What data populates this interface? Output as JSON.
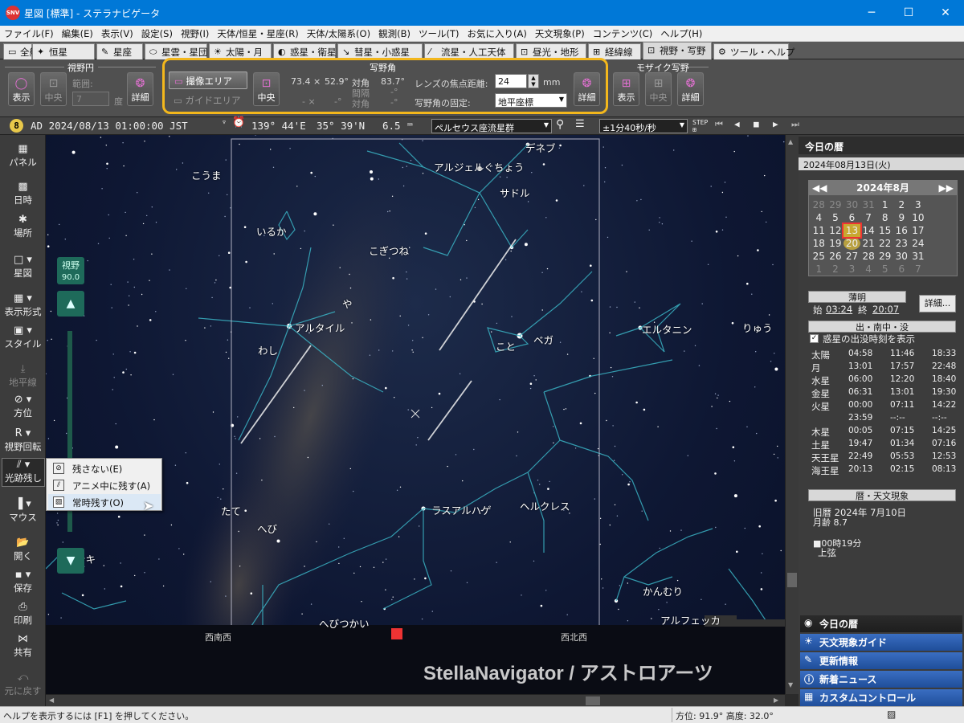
{
  "window": {
    "title": "星図 [標準] - ステラナビゲータ",
    "app_badge": "SNV"
  },
  "menu": [
    "ファイル(F)",
    "編集(E)",
    "表示(V)",
    "設定(S)",
    "視野(I)",
    "天体/恒星・星座(R)",
    "天体/太陽系(O)",
    "観測(B)",
    "ツール(T)",
    "お気に入り(A)",
    "天文現象(P)",
    "コンテンツ(C)",
    "ヘルプ(H)"
  ],
  "tabs": [
    {
      "label": "全般",
      "icon": "▭"
    },
    {
      "label": "恒星",
      "icon": "✦"
    },
    {
      "label": "星座",
      "icon": "✎"
    },
    {
      "label": "星雲・星団",
      "icon": "⬭"
    },
    {
      "label": "太陽・月",
      "icon": "☀"
    },
    {
      "label": "惑星・衛星",
      "icon": "◐"
    },
    {
      "label": "彗星・小惑星",
      "icon": "↘"
    },
    {
      "label": "流星・人工天体",
      "icon": "⁄"
    },
    {
      "label": "昼光・地形",
      "icon": "⊡"
    },
    {
      "label": "経緯線",
      "icon": "⊞"
    },
    {
      "label": "視野・写野",
      "icon": "⊡"
    },
    {
      "label": "ツール・ヘルプ",
      "icon": "⚙"
    }
  ],
  "ribbon": {
    "fov_circle": {
      "title": "視野円",
      "show": "表示",
      "center": "中央",
      "range_label": "範囲:",
      "range_value": "7",
      "unit": "度",
      "detail": "詳細"
    },
    "frame": {
      "title": "写野角",
      "capture_area": "撮像エリア",
      "guide_area": "ガイドエリア",
      "center": "中央",
      "size_a": "73.4 ×",
      "size_b": "52.9°",
      "diag_label": "対角",
      "diag_value": "83.7°",
      "dash_a": "- ×",
      "dash_b": "-°",
      "spacing_label": "間隔",
      "spacing_value": "-°",
      "diag2_label": "対角",
      "diag2_value": "-°",
      "focal_label": "レンズの焦点距離:",
      "focal_value": "24",
      "focal_unit": "mm",
      "fix_label": "写野角の固定:",
      "fix_value": "地平座標",
      "detail": "詳細"
    },
    "mosaic": {
      "title": "モザイク写野",
      "show": "表示",
      "center": "中央",
      "detail": "詳細"
    }
  },
  "status": {
    "badge": "8",
    "datetime": "AD 2024/08/13 01:00:00 JST",
    "lon": "139° 44'E",
    "lat": "35° 39'N",
    "mag": "6.5",
    "target": "ペルセウス座流星群",
    "speed": "±1分40秒/秒"
  },
  "leftbar": {
    "panel": "パネル",
    "datetime": "日時",
    "place": "場所",
    "chart": "星図",
    "display": "表示形式",
    "style": "スタイル",
    "horizon": "地平線",
    "direction": "方位",
    "rotate": "視野回転",
    "trail": "光跡残し",
    "mouse": "マウス",
    "open": "開く",
    "save": "保存",
    "print": "印刷",
    "share": "共有",
    "undo": "元に戻す",
    "fov_label": "視野",
    "fov_value": "90.0"
  },
  "popup": [
    "残さない(E)",
    "アニメ中に残す(A)",
    "常時残す(O)"
  ],
  "sky": {
    "labels": [
      "デネブ",
      "アルジェルぐちょう",
      "サドル",
      "こうま",
      "いるか",
      "こぎつね",
      "や",
      "アルタイル",
      "わし",
      "こと",
      "ベガ",
      "エルタニン",
      "りゅう",
      "たて",
      "へび",
      "ラスアルハゲ",
      "ヘルクレス",
      "アンキ",
      "へびつかい",
      "かんむり",
      "アルフェッカ",
      "西南西",
      "西北西"
    ],
    "watermark": "StellaNavigator / アストロアーツ"
  },
  "right": {
    "title": "今日の暦",
    "date": "2024年08月13日(火)",
    "cal_month": "2024年8月",
    "cal_weeks": [
      [
        "28",
        "29",
        "30",
        "31",
        "1",
        "2",
        "3"
      ],
      [
        "4",
        "5",
        "6",
        "7",
        "8",
        "9",
        "10"
      ],
      [
        "11",
        "12",
        "13",
        "14",
        "15",
        "16",
        "17"
      ],
      [
        "18",
        "19",
        "20",
        "21",
        "22",
        "23",
        "24"
      ],
      [
        "25",
        "26",
        "27",
        "28",
        "29",
        "30",
        "31"
      ],
      [
        "1",
        "2",
        "3",
        "4",
        "5",
        "6",
        "7"
      ]
    ],
    "twilight_title": "薄明",
    "tw_start_label": "始",
    "tw_start": "03:24",
    "tw_end_label": "終",
    "tw_end": "20:07",
    "detail_btn": "詳細...",
    "rise_title": "出・南中・没",
    "planet_check": "惑星の出没時刻を表示",
    "rise_rows": [
      [
        "太陽",
        "04:58",
        "11:46",
        "18:33"
      ],
      [
        "月",
        "13:01",
        "17:57",
        "22:48"
      ],
      [
        "水星",
        "06:00",
        "12:20",
        "18:40"
      ],
      [
        "金星",
        "06:31",
        "13:01",
        "19:30"
      ],
      [
        "火星",
        "00:00",
        "07:11",
        "14:22"
      ],
      [
        "",
        "23:59",
        "--:--",
        "--:--"
      ],
      [
        "木星",
        "00:05",
        "07:15",
        "14:25"
      ],
      [
        "土星",
        "19:47",
        "01:34",
        "07:16"
      ],
      [
        "天王星",
        "22:49",
        "05:53",
        "12:53"
      ],
      [
        "海王星",
        "20:13",
        "02:15",
        "08:13"
      ]
    ],
    "cal_title": "暦・天文現象",
    "lunar": "旧暦  2024年 7月10日",
    "moon_age": "月齢  8.7",
    "event_time": "■00時19分",
    "event": "上弦",
    "tabs": [
      "今日の暦",
      "天文現象ガイド",
      "更新情報",
      "新着ニュース",
      "カスタムコントロール"
    ]
  },
  "bottom": {
    "help": "ヘルプを表示するには [F1] を押してください。",
    "az": "方位:  91.9°  高度:  32.0°"
  }
}
